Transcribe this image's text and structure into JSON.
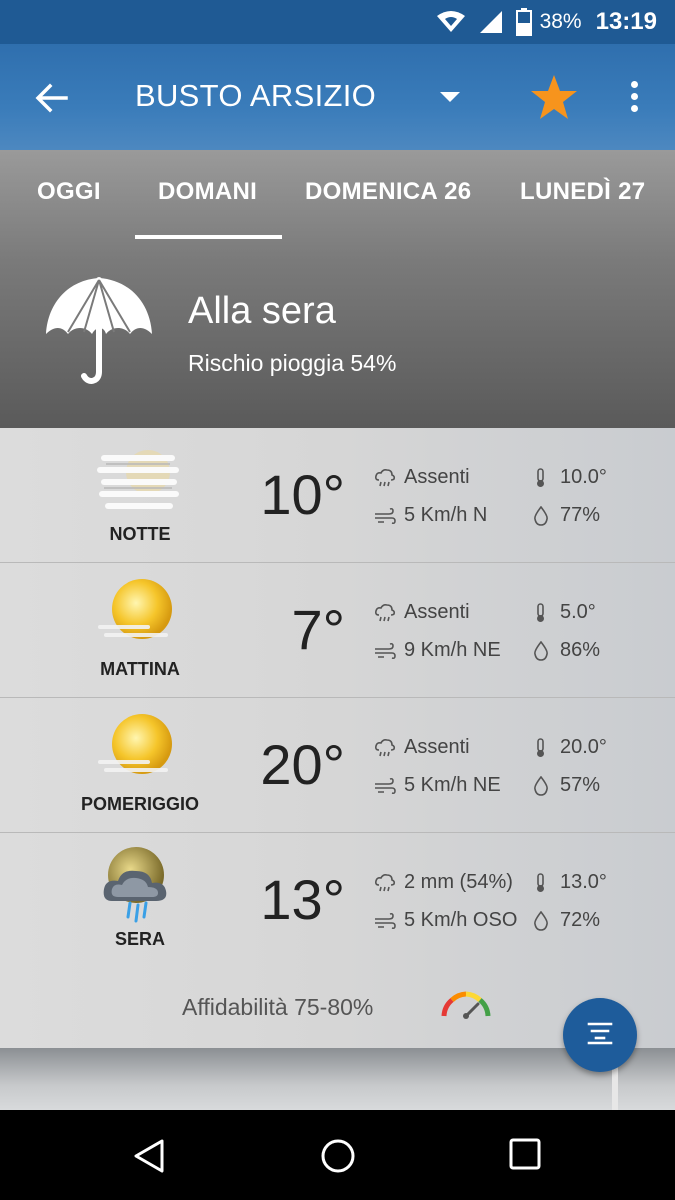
{
  "status_bar": {
    "battery_percent": "38%",
    "time": "13:19",
    "icons": [
      "wifi-icon",
      "signal-icon",
      "battery-icon"
    ]
  },
  "app_bar": {
    "title": "BUSTO ARSIZIO",
    "icons": [
      "back-arrow-icon",
      "dropdown-arrow-icon",
      "star-icon",
      "more-vert-icon"
    ],
    "star_color": "#f7941d"
  },
  "tabs": [
    {
      "label": "OGGI"
    },
    {
      "label": "DOMANI",
      "selected": true
    },
    {
      "label": "DOMENICA 26"
    },
    {
      "label": "LUNEDÌ 27"
    }
  ],
  "summary": {
    "icon": "umbrella-icon",
    "when": "Alla sera",
    "rain_risk": "Rischio pioggia 54%"
  },
  "forecast": [
    {
      "period": "NOTTE",
      "icon": "fog-icon",
      "temp": "10°",
      "precip": "Assenti",
      "wind": "5 Km/h N",
      "perceived": "10.0°",
      "humidity": "77%"
    },
    {
      "period": "MATTINA",
      "icon": "sun-haze-icon",
      "temp": "7°",
      "precip": "Assenti",
      "wind": "9 Km/h NE",
      "perceived": "5.0°",
      "humidity": "86%"
    },
    {
      "period": "POMERIGGIO",
      "icon": "sun-haze-icon",
      "temp": "20°",
      "precip": "Assenti",
      "wind": "5 Km/h NE",
      "perceived": "20.0°",
      "humidity": "57%"
    },
    {
      "period": "SERA",
      "icon": "rain-cloud-icon",
      "temp": "13°",
      "precip": "2 mm (54%)",
      "wind": "5 Km/h OSO",
      "perceived": "13.0°",
      "humidity": "72%"
    }
  ],
  "reliability": "Affidabilità 75-80%",
  "fab": {
    "icon": "filter-list-icon",
    "color": "#1e5c9b"
  },
  "nav_bar": {
    "icons": [
      "nav-back-icon",
      "nav-home-icon",
      "nav-recents-icon"
    ]
  }
}
